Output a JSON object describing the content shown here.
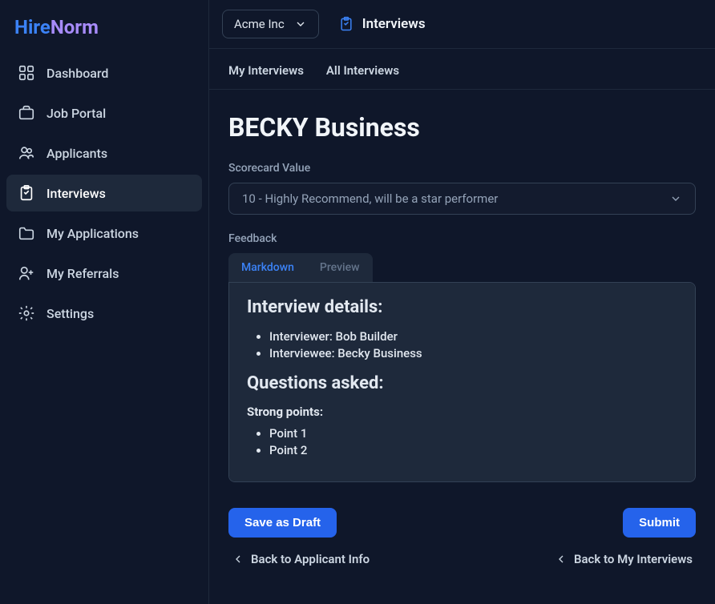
{
  "logo": {
    "part1": "Hire",
    "part2": "Norm"
  },
  "sidebar": {
    "items": [
      {
        "label": "Dashboard",
        "icon": "dashboard"
      },
      {
        "label": "Job Portal",
        "icon": "briefcase"
      },
      {
        "label": "Applicants",
        "icon": "users"
      },
      {
        "label": "Interviews",
        "icon": "clipboard",
        "active": true
      },
      {
        "label": "My Applications",
        "icon": "folder"
      },
      {
        "label": "My Referrals",
        "icon": "user-plus"
      },
      {
        "label": "Settings",
        "icon": "gear"
      }
    ]
  },
  "topbar": {
    "org": "Acme Inc",
    "breadcrumb": "Interviews"
  },
  "tabs": [
    {
      "label": "My Interviews"
    },
    {
      "label": "All Interviews"
    }
  ],
  "page": {
    "title": "BECKY Business",
    "scorecard_label": "Scorecard Value",
    "scorecard_value": "10 - Highly Recommend, will be a star performer",
    "feedback_label": "Feedback",
    "editor_tabs": {
      "markdown": "Markdown",
      "preview": "Preview"
    },
    "preview": {
      "heading1": "Interview details:",
      "interviewer": "Interviewer: Bob Builder",
      "interviewee": "Interviewee: Becky Business",
      "heading2": "Questions asked:",
      "strong_label": "Strong points:",
      "points": [
        "Point 1",
        "Point 2"
      ]
    },
    "actions": {
      "save_draft": "Save as Draft",
      "submit": "Submit"
    },
    "footer": {
      "back_applicant": "Back to Applicant Info",
      "back_interviews": "Back to My Interviews"
    }
  }
}
